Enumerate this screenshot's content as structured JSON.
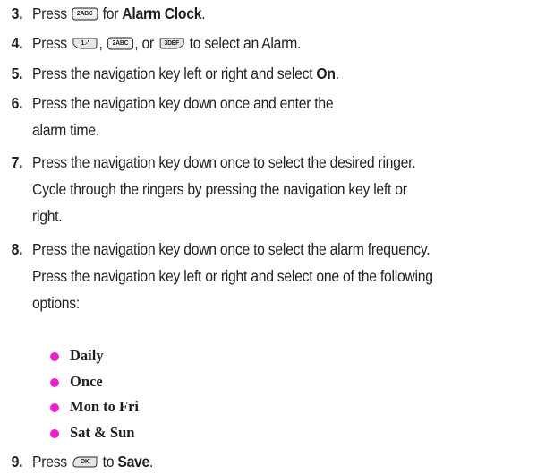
{
  "steps": [
    {
      "number": "3.",
      "pre": "Press",
      "key1": "2ABC",
      "mid": "for",
      "bold": "Alarm Clock",
      "post": "."
    },
    {
      "number": "4.",
      "pre": "Press",
      "key1": "1.-'",
      "sep1": ",",
      "key2": "2ABC",
      "sep2": ", or",
      "key3": "3DEF",
      "post": "to select an Alarm."
    },
    {
      "number": "5.",
      "text": "Press the navigation key left or right and select",
      "bold": "On",
      "post": "."
    },
    {
      "number": "6.",
      "text": "Press the navigation key down once and enter the\nalarm time."
    },
    {
      "number": "7.",
      "text": "Press the navigation key down once to select the desired ringer.\nCycle through the ringers by pressing the navigation key left or\nright."
    },
    {
      "number": "8.",
      "text": "Press the navigation key down once to select the alarm frequency.\nPress the navigation key left or right and select one of the following\noptions:"
    },
    {
      "number": "9.",
      "pre": "Press",
      "key1": "OK",
      "mid": "to",
      "bold": "Save",
      "post": "."
    }
  ],
  "options": [
    "Daily",
    "Once",
    "Mon to Fri",
    "Sat & Sun"
  ],
  "colors": {
    "bullet": "#ed1fd0",
    "text": "#231f20",
    "key_fill": "#d9d9d9",
    "key_stroke": "#231f20"
  },
  "icons": [
    "key-2abc-icon",
    "key-1-icon",
    "key-3def-icon",
    "key-ok-icon"
  ]
}
